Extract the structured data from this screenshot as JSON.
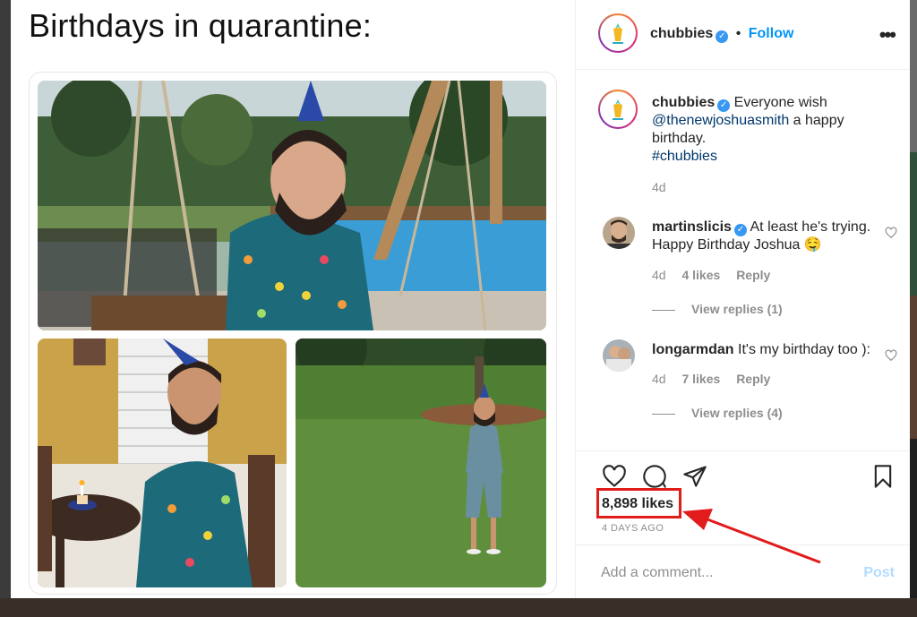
{
  "post": {
    "title": "Birthdays in quarantine:"
  },
  "header": {
    "username": "chubbies",
    "separator": "•",
    "follow_label": "Follow",
    "more_label": "•••"
  },
  "caption": {
    "username": "chubbies",
    "text_before": " Everyone wish ",
    "mention": "@thenewjoshuasmith",
    "text_after": " a happy birthday.",
    "hashtag": "#chubbies",
    "age": "4d"
  },
  "comments": [
    {
      "username": "martinslicis",
      "verified": true,
      "text": " At least he's trying. Happy Birthday Joshua 🤤",
      "age": "4d",
      "likes": "4 likes",
      "reply_label": "Reply",
      "view_replies": "View replies (1)"
    },
    {
      "username": "longarmdan",
      "verified": false,
      "text": " It's my birthday too ):",
      "age": "4d",
      "likes": "7 likes",
      "reply_label": "Reply",
      "view_replies": "View replies (4)"
    }
  ],
  "actions": {
    "likes_count": "8,898 likes",
    "posted_ago": "4 DAYS AGO"
  },
  "add_comment": {
    "placeholder": "Add a comment...",
    "post_label": "Post"
  },
  "colors": {
    "accent": "#0095f6",
    "annotation": "#e21b1b",
    "muted": "#8e8e8e"
  }
}
